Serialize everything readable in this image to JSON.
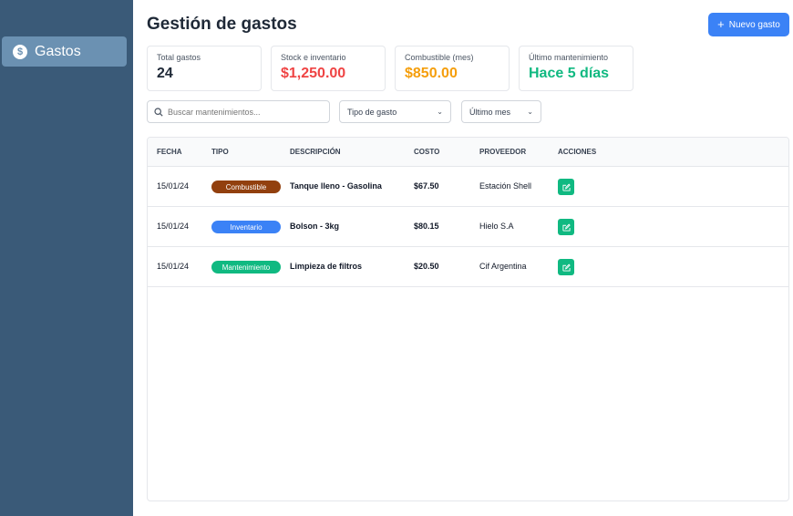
{
  "sidebar": {
    "items": [
      {
        "label": "Gastos",
        "icon": "dollar-icon",
        "active": true
      }
    ]
  },
  "header": {
    "title": "Gestión de gastos",
    "new_button_label": "Nuevo gasto"
  },
  "cards": [
    {
      "label": "Total gastos",
      "value": "24",
      "color": "#1f2937"
    },
    {
      "label": "Stock e inventario",
      "value": "$1,250.00",
      "color": "#ef4444"
    },
    {
      "label": "Combustible (mes)",
      "value": "$850.00",
      "color": "#f59e0b"
    },
    {
      "label": "Último mantenimiento",
      "value": "Hace 5 días",
      "color": "#10b981"
    }
  ],
  "filters": {
    "search_placeholder": "Buscar mantenimientos...",
    "type_select": "Tipo de gasto",
    "period_select": "Último mes"
  },
  "table": {
    "headers": {
      "fecha": "FECHA",
      "tipo": "TIPO",
      "descripcion": "DESCRIPCIÓN",
      "costo": "COSTO",
      "proveedor": "PROVEEDOR",
      "acciones": "ACCIONES"
    },
    "rows": [
      {
        "fecha": "15/01/24",
        "tipo": "Combustible",
        "tipo_color": "#92400e",
        "descripcion": "Tanque lleno - Gasolina",
        "costo": "$67.50",
        "proveedor": "Estación Shell"
      },
      {
        "fecha": "15/01/24",
        "tipo": "Inventario",
        "tipo_color": "#3b82f6",
        "descripcion": "Bolson - 3kg",
        "costo": "$80.15",
        "proveedor": "Hielo S.A"
      },
      {
        "fecha": "15/01/24",
        "tipo": "Mantenimiento",
        "tipo_color": "#10b981",
        "descripcion": "Limpieza de filtros",
        "costo": "$20.50",
        "proveedor": "Cif Argentina"
      }
    ]
  },
  "colors": {
    "sidebar_bg": "#3a5a78",
    "sidebar_active": "#6b91b2",
    "primary": "#3b82f6",
    "edit_button": "#10b981"
  }
}
